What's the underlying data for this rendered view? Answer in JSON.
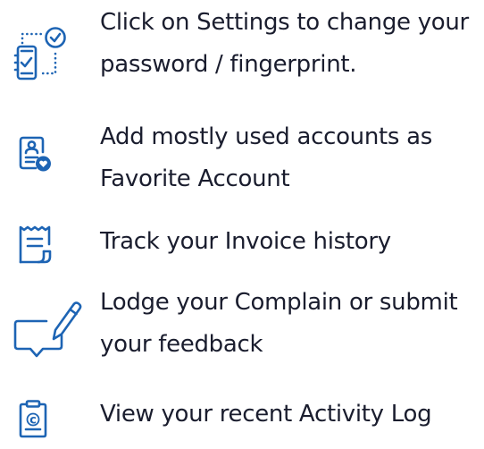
{
  "items": [
    {
      "icon": "phone-clock-icon",
      "lines": [
        "Click on Settings to change your",
        "password / fingerprint."
      ]
    },
    {
      "icon": "favorite-account-icon",
      "lines": [
        "Add mostly used accounts as",
        "Favorite Account"
      ]
    },
    {
      "icon": "invoice-receipt-icon",
      "lines": [
        "Track your Invoice history"
      ]
    },
    {
      "icon": "complaint-feedback-icon",
      "lines": [
        "Lodge your Complain or submit",
        "your feedback"
      ]
    },
    {
      "icon": "activity-log-icon",
      "lines": [
        "View your recent Activity Log"
      ]
    }
  ],
  "colors": {
    "icon": "#1d64b4",
    "text": "#1a1d2e"
  }
}
